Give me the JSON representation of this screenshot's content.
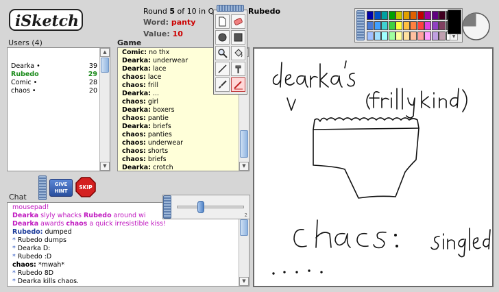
{
  "header": {
    "round_prefix": "Round ",
    "round_num": "5",
    "round_mid": " of 10 in ",
    "round_suffix": "Q",
    "drawer": "Rubedo",
    "word_label": "Word: ",
    "word_value": "panty",
    "value_label": "Value: ",
    "value_value": "10"
  },
  "users": {
    "label": "Users (4)",
    "list": [
      {
        "name": "Dearka •",
        "score": "39"
      },
      {
        "name": "Rubedo",
        "score": "29"
      },
      {
        "name": "Comic •",
        "score": "28"
      },
      {
        "name": "chaos •",
        "score": "20"
      }
    ]
  },
  "game": {
    "label": "Game",
    "guesses": [
      {
        "who": "Comic:",
        "text": " no thx"
      },
      {
        "who": "Dearka:",
        "text": " underwear"
      },
      {
        "who": "Dearka:",
        "text": " lace"
      },
      {
        "who": "chaos:",
        "text": " lace"
      },
      {
        "who": "chaos:",
        "text": " frill"
      },
      {
        "who": "Dearka:",
        "text": " ..."
      },
      {
        "who": "chaos:",
        "text": " girl"
      },
      {
        "who": "Dearka:",
        "text": " boxers"
      },
      {
        "who": "chaos:",
        "text": " pantie"
      },
      {
        "who": "Dearka:",
        "text": " briefs"
      },
      {
        "who": "chaos:",
        "text": " panties"
      },
      {
        "who": "chaos:",
        "text": " underwear"
      },
      {
        "who": "chaos:",
        "text": " shorts"
      },
      {
        "who": "chaos:",
        "text": " briefs"
      },
      {
        "who": "Dearka:",
        "text": " crotch"
      }
    ]
  },
  "chat": {
    "label": "Chat",
    "lines": [
      {
        "a": "mousepad!",
        "b": "",
        "c": "",
        "d": "",
        "style": "magenta-plain"
      },
      {
        "a": "Dearka",
        "b": " slyly whacks ",
        "c": "Rubedo",
        "d": " around wi",
        "style": "magenta"
      },
      {
        "a": "Dearka",
        "b": " awards ",
        "c": "chaos",
        "d": " a quick irresistible kiss!",
        "style": "magenta"
      },
      {
        "a": "Rubedo:",
        "b": " dumped",
        "c": "",
        "d": "",
        "style": "blue"
      },
      {
        "a": "* ",
        "b": "Rubedo dumps",
        "c": "",
        "d": "",
        "style": "star"
      },
      {
        "a": "* ",
        "b": "Dearka D:",
        "c": "",
        "d": "",
        "style": "star"
      },
      {
        "a": "* ",
        "b": "Rubedo :D",
        "c": "",
        "d": "",
        "style": "star"
      },
      {
        "a": "chaos:",
        "b": " *mwah*",
        "c": "",
        "d": "",
        "style": "black"
      },
      {
        "a": "* ",
        "b": "Rubedo 8D",
        "c": "",
        "d": "",
        "style": "star"
      },
      {
        "a": "* ",
        "b": "Dearka kills chaos.",
        "c": "",
        "d": "",
        "style": "star"
      }
    ]
  },
  "buttons": {
    "hint_top": "GIVE",
    "hint_bottom": "HINT",
    "skip": "SKIP"
  },
  "slider": {
    "value_fraction": 0.36,
    "max_label": "2"
  },
  "colors": {
    "swatches": [
      "#0000aa",
      "#0050c8",
      "#00a0a0",
      "#00a000",
      "#c8c800",
      "#e0a000",
      "#e06000",
      "#c00000",
      "#a000a0",
      "#600080",
      "#400020",
      "#000000",
      "#4a7ad6",
      "#40a0ff",
      "#40d0d0",
      "#40d040",
      "#ffff40",
      "#ffc040",
      "#ff8040",
      "#ff4040",
      "#e040e0",
      "#9040c0",
      "#804060",
      "#606060",
      "#a0c0ff",
      "#a0e0ff",
      "#a0ffff",
      "#a0ffa0",
      "#ffffa0",
      "#ffe0a0",
      "#ffc0a0",
      "#ffa0a0",
      "#ffa0ff",
      "#c0a0e0",
      "#c0a0b0",
      "#ffffff"
    ],
    "current": "#000000"
  },
  "tools": [
    "new-page-icon",
    "eraser-icon",
    "fill-circle-icon",
    "fill-square-icon",
    "zoom-icon",
    "bucket-icon",
    "line-icon",
    "hammer-icon",
    "brush-icon",
    "pen-icon"
  ]
}
